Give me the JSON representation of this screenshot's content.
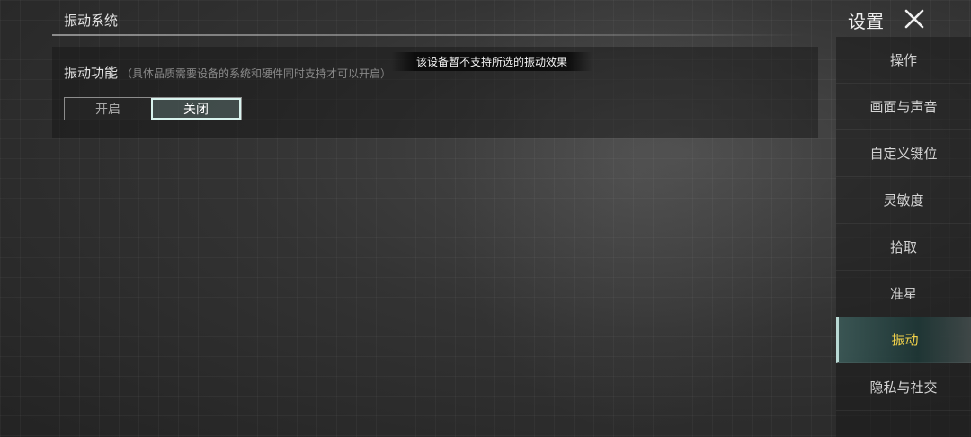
{
  "header": {
    "section_title": "振动系统",
    "settings_label": "设置"
  },
  "vibration": {
    "label": "振动功能",
    "note": "（具体品质需要设备的系统和硬件同时支持才可以开启）",
    "options": [
      {
        "label": "开启",
        "selected": false
      },
      {
        "label": "关闭",
        "selected": true
      }
    ]
  },
  "toast": {
    "message": "该设备暂不支持所选的振动效果"
  },
  "sidebar": {
    "items": [
      {
        "label": "操作"
      },
      {
        "label": "画面与声音"
      },
      {
        "label": "自定义键位"
      },
      {
        "label": "灵敏度"
      },
      {
        "label": "拾取"
      },
      {
        "label": "准星"
      },
      {
        "label": "振动"
      },
      {
        "label": "隐私与社交"
      }
    ],
    "active_index": 6
  },
  "colors": {
    "active_text": "#f3d34a",
    "selected_border": "#d8f3ee"
  },
  "icons": {
    "close": "close-icon"
  }
}
